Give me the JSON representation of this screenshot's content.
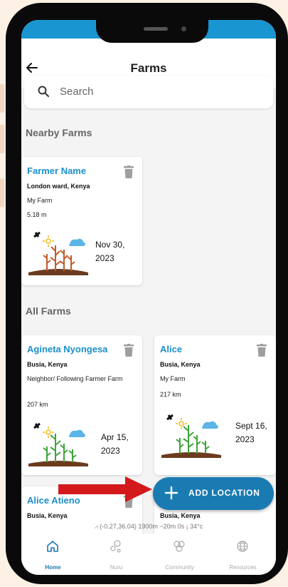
{
  "header": {
    "title": "Farms"
  },
  "search": {
    "placeholder": "Search"
  },
  "sections": {
    "nearby": "Nearby Farms",
    "all": "All Farms"
  },
  "nearby_farms": [
    {
      "name": "Farmer Name",
      "location": "London ward, Kenya",
      "type": "My Farm",
      "distance": "5.18 m",
      "date": "Nov 30, 2023",
      "date_line1": "Nov 30,",
      "date_line2": "2023",
      "illustration": "dry-crops"
    }
  ],
  "all_farms": [
    {
      "name": "Agineta Nyongesa",
      "location": "Busia, Kenya",
      "type": "Neighbor/ Following Farmer Farm",
      "distance": "207 km",
      "date": "Apr 15, 2023",
      "date_line1": "Apr 15,",
      "date_line2": "2023",
      "illustration": "green-crops"
    },
    {
      "name": "Alice",
      "location": "Busia, Kenya",
      "type": "My Farm",
      "distance": "217 km",
      "date": "Sept 16, 2023",
      "date_line1": "Sept 16,",
      "date_line2": "2023",
      "illustration": "green-crops"
    },
    {
      "name": "Alice Atieno",
      "location": "Busia, Kenya"
    },
    {
      "name": "",
      "location": "Busia, Kenya"
    }
  ],
  "fab": {
    "label": "ADD LOCATION"
  },
  "gps_status": {
    "coords": "(-0.27,36.04) 1900m ~20m 0s",
    "temperature": "34°c"
  },
  "bottom_nav": [
    {
      "label": "Home",
      "icon": "home-icon",
      "active": true
    },
    {
      "label": "Nuru",
      "icon": "nuru-icon",
      "active": false
    },
    {
      "label": "Community",
      "icon": "community-icon",
      "active": false
    },
    {
      "label": "Resources",
      "icon": "globe-icon",
      "active": false
    }
  ],
  "colors": {
    "accent": "#1a8fc9",
    "status_bar": "#1996d1",
    "fab": "#1a7bb3",
    "arrow": "#d4191c",
    "frame_bg": "#fdf0e4"
  },
  "icons": {
    "back": "arrow-left-icon",
    "search": "search-icon",
    "delete": "trash-icon",
    "add": "plus-icon"
  }
}
